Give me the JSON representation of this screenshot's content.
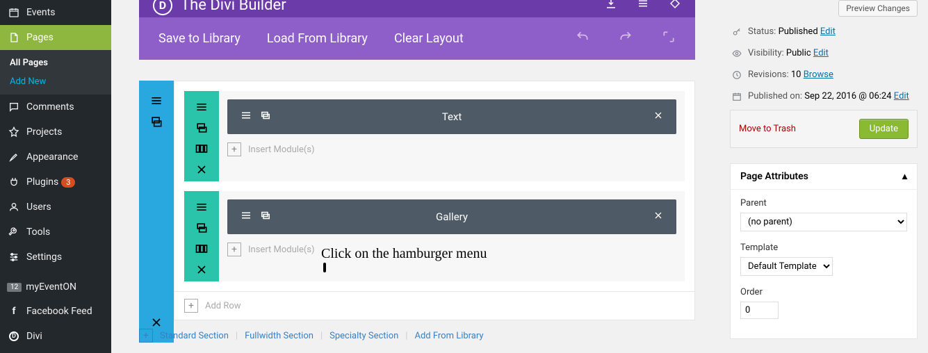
{
  "sidebar": {
    "events": "Events",
    "pages": "Pages",
    "all_pages": "All Pages",
    "add_new": "Add New",
    "comments": "Comments",
    "projects": "Projects",
    "appearance": "Appearance",
    "plugins": "Plugins",
    "plugins_badge": "3",
    "users": "Users",
    "tools": "Tools",
    "settings": "Settings",
    "myeventon": "myEventON",
    "myeventon_badge": "12",
    "facebook_feed": "Facebook Feed",
    "divi": "Divi"
  },
  "builder": {
    "title": "The Divi Builder",
    "save_lib": "Save to Library",
    "load_lib": "Load From Library",
    "clear_layout": "Clear Layout",
    "modules": {
      "text": "Text",
      "gallery": "Gallery"
    },
    "insert_modules": "Insert Module(s)",
    "add_row": "Add Row",
    "standard_section": "Standard Section",
    "fullwidth_section": "Fullwidth Section",
    "specialty_section": "Specialty Section",
    "add_from_library": "Add From Library"
  },
  "publish": {
    "preview_changes": "Preview Changes",
    "status_label": "Status:",
    "status_value": "Published",
    "edit": "Edit",
    "visibility_label": "Visibility:",
    "visibility_value": "Public",
    "revisions_label": "Revisions:",
    "revisions_value": "10",
    "browse": "Browse",
    "published_label": "Published on:",
    "published_value": "Sep 22, 2016 @ 06:24",
    "trash": "Move to Trash",
    "update": "Update"
  },
  "attrs": {
    "panel_title": "Page Attributes",
    "parent_label": "Parent",
    "parent_value": "(no parent)",
    "template_label": "Template",
    "template_value": "Default Template",
    "order_label": "Order",
    "order_value": "0"
  },
  "annotation": "Click on the hamburger menu"
}
